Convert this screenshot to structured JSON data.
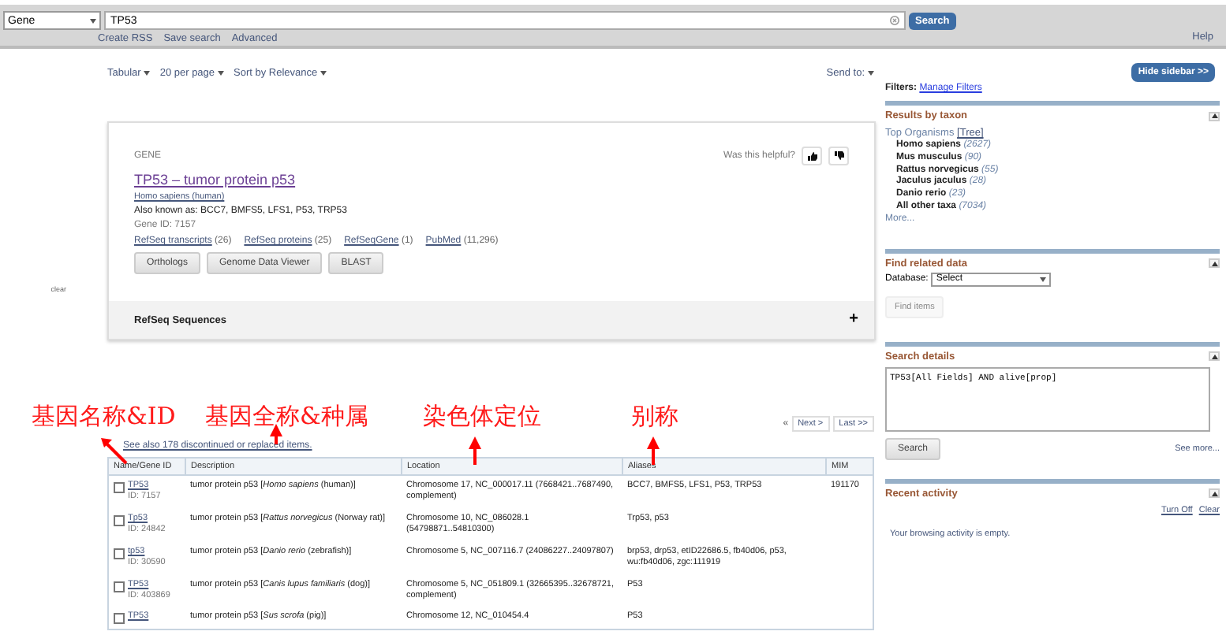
{
  "search_bar": {
    "database": "Gene",
    "query": "TP53",
    "button": "Search",
    "links": [
      "Create RSS",
      "Save search",
      "Advanced"
    ],
    "help": "Help"
  },
  "display_options": [
    "Tabular",
    "20 per page",
    "Sort by Relevance"
  ],
  "send_to": "Send to:",
  "gene_card": {
    "label": "GENE",
    "helpful_prompt": "Was this helpful?",
    "title": "TP53 – tumor protein p53",
    "organism": "Homo sapiens (human)",
    "also_known_as": "Also known as: BCC7, BMFS5, LFS1, P53, TRP53",
    "gene_id": "Gene ID: 7157",
    "links": [
      {
        "label": "RefSeq transcripts",
        "count": "(26)"
      },
      {
        "label": "RefSeq proteins",
        "count": "(25)"
      },
      {
        "label": "RefSeqGene",
        "count": "(1)"
      },
      {
        "label": "PubMed",
        "count": "(11,296)"
      }
    ],
    "buttons": [
      "Orthologs",
      "Genome Data Viewer",
      "BLAST"
    ],
    "section": {
      "title": "RefSeq Sequences",
      "expand": "+",
      "expanded": false
    }
  },
  "clear_label": "clear",
  "annotations": [
    {
      "text": "基因名称&ID",
      "kind": "diagonal"
    },
    {
      "text": "基因全称&种属",
      "kind": "vertical"
    },
    {
      "text": "染色体定位",
      "kind": "vertical"
    },
    {
      "text": "别称",
      "kind": "vertical"
    }
  ],
  "see_also": "See also 178 discontinued or replaced items.",
  "pagination": {
    "first": "«",
    "next": "Next >",
    "last": "Last >>"
  },
  "table": {
    "columns": [
      "Name/Gene ID",
      "Description",
      "Location",
      "Aliases",
      "MIM"
    ],
    "rows": [
      {
        "checked": false,
        "name": "TP53",
        "id": "ID: 7157",
        "description": "tumor protein p53 [*Homo sapiens* (human)]",
        "location": "Chromosome 17, NC_000017.11 (7668421..7687490, complement)",
        "aliases": "BCC7, BMFS5, LFS1, P53, TRP53",
        "mim": "191170"
      },
      {
        "checked": false,
        "name": "Tp53",
        "id": "ID: 24842",
        "description": "tumor protein p53 [*Rattus norvegicus* (Norway rat)]",
        "location": "Chromosome 10, NC_086028.1 (54798871..54810300)",
        "aliases": "Trp53, p53"
      },
      {
        "checked": false,
        "name": "tp53",
        "id": "ID: 30590",
        "description": "tumor protein p53 [*Danio rerio* (zebrafish)]",
        "location": "Chromosome 5, NC_007116.7 (24086227..24097807)",
        "aliases": "brp53, drp53, etID22686.5, fb40d06, p53, wu:fb40d06, zgc:111919"
      },
      {
        "checked": false,
        "name": "TP53",
        "id": "ID: 403869",
        "description": "tumor protein p53 [*Canis lupus familiaris* (dog)]",
        "location": "Chromosome 5, NC_051809.1 (32665395..32678721, complement)",
        "aliases": "P53"
      },
      {
        "checked": false,
        "name": "TP53",
        "description": "tumor protein p53 [*Sus scrofa* (pig)]",
        "location": "Chromosome 12, NC_010454.4",
        "aliases": "P53"
      }
    ]
  },
  "sidebar": {
    "hide_button": "Hide sidebar >>",
    "filters_label": "Filters:",
    "manage_filters": "Manage Filters",
    "taxon": {
      "title": "Results by taxon",
      "top_label": "Top Organisms",
      "tree": "[Tree]",
      "organisms": [
        {
          "name": "Homo sapiens",
          "count": "(2627)"
        },
        {
          "name": "Mus musculus",
          "count": "(90)"
        },
        {
          "name": "Rattus norvegicus",
          "count": "(55)"
        },
        {
          "name": "Jaculus jaculus",
          "count": "(28)"
        },
        {
          "name": "Danio rerio",
          "count": "(23)"
        },
        {
          "name": "All other taxa",
          "count": "(7034)"
        }
      ],
      "more": "More..."
    },
    "related": {
      "title": "Find related data",
      "database_label": "Database:",
      "database_value": "Select",
      "button": "Find items",
      "button_disabled": true
    },
    "details": {
      "title": "Search details",
      "query": "TP53[All Fields] AND alive[prop]",
      "button": "Search",
      "see_more": "See more..."
    },
    "recent": {
      "title": "Recent activity",
      "links": [
        "Turn Off",
        "Clear"
      ],
      "empty": "Your browsing activity is empty."
    }
  }
}
